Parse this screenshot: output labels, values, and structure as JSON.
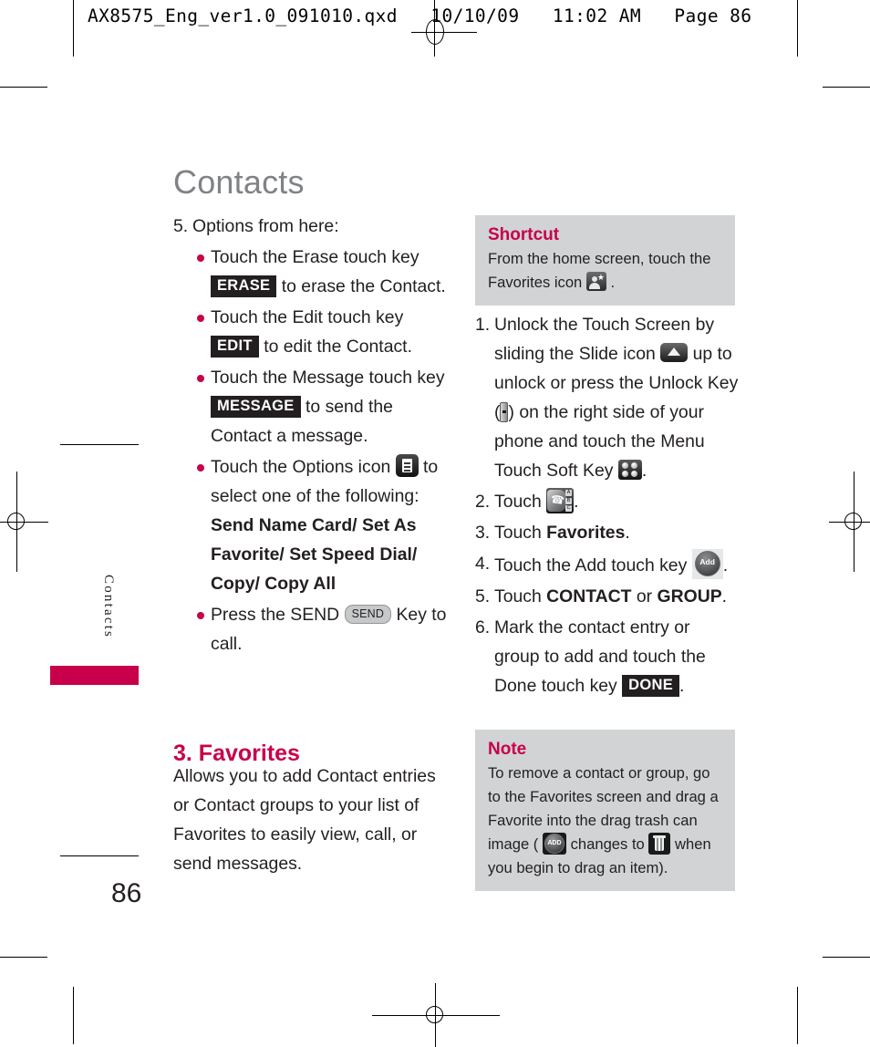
{
  "header": {
    "text": "AX8575_Eng_ver1.0_091010.qxd   10/10/09   11:02 AM   Page 86"
  },
  "page": {
    "chapter_title": "Contacts",
    "side_tab_label": "Contacts",
    "page_number": "86",
    "accent_color": "#c8004b",
    "callout_bg": "#d1d3d4",
    "title_color": "#808285"
  },
  "left_column": {
    "step5": {
      "number": "5.",
      "text": "Options from here:",
      "bullets": [
        {
          "before": "Touch the Erase touch key",
          "chip": "ERASE",
          "after": "to erase the Contact."
        },
        {
          "before": "Touch the Edit touch key",
          "chip": "EDIT",
          "after": "to edit the Contact."
        },
        {
          "before": "Touch the Message touch key",
          "chip": "MESSAGE",
          "after": "to send the Contact a message."
        },
        {
          "before": "Touch the Options icon",
          "icon": "options-icon",
          "after": "to select one of the following:",
          "options_bold": "Send Name Card/ Set As Favorite/ Set Speed Dial/ Copy/ Copy All"
        },
        {
          "before": "Press the SEND",
          "key": "SEND",
          "after": "Key to call."
        }
      ]
    },
    "section": {
      "heading": "3. Favorites",
      "description": "Allows you to add Contact entries or Contact groups to your list of Favorites to easily view, call, or send messages."
    }
  },
  "right_column": {
    "shortcut": {
      "title": "Shortcut",
      "text_before": "From the home screen, touch the Favorites icon",
      "icon": "favorites-icon",
      "text_after": "."
    },
    "steps": [
      {
        "number": "1.",
        "parts": {
          "p1": "Unlock the Touch Screen by sliding the Slide icon",
          "icon1": "slide-up-icon",
          "p2": "up to unlock or press the Unlock Key (",
          "icon2": "unlock-key-icon",
          "p3": ") on the right side of your phone and touch the Menu Touch Soft Key",
          "icon3": "menu-soft-key-icon",
          "p4": "."
        }
      },
      {
        "number": "2.",
        "parts": {
          "p1": "Touch",
          "icon1": "contacts-icon",
          "p2": "."
        }
      },
      {
        "number": "3.",
        "parts": {
          "p1": "Touch",
          "bold1": "Favorites",
          "p2": "."
        }
      },
      {
        "number": "4.",
        "parts": {
          "p1": "Touch the Add touch key",
          "icon1": "add-touch-key-icon",
          "p2": "."
        }
      },
      {
        "number": "5.",
        "parts": {
          "p1": "Touch",
          "bold1": "CONTACT",
          "p2": "or",
          "bold2": "GROUP",
          "p3": "."
        }
      },
      {
        "number": "6.",
        "parts": {
          "p1": "Mark the contact entry or group to add and touch the Done touch key",
          "chip1": "DONE",
          "p2": "."
        }
      }
    ],
    "note": {
      "title": "Note",
      "p1": "To remove a contact or group, go to the Favorites screen and drag a Favorite into the drag trash can image (",
      "icon1": "add-round-icon",
      "p2": "changes to",
      "icon2": "trash-can-icon",
      "p3": "when you begin to drag an item)."
    }
  }
}
